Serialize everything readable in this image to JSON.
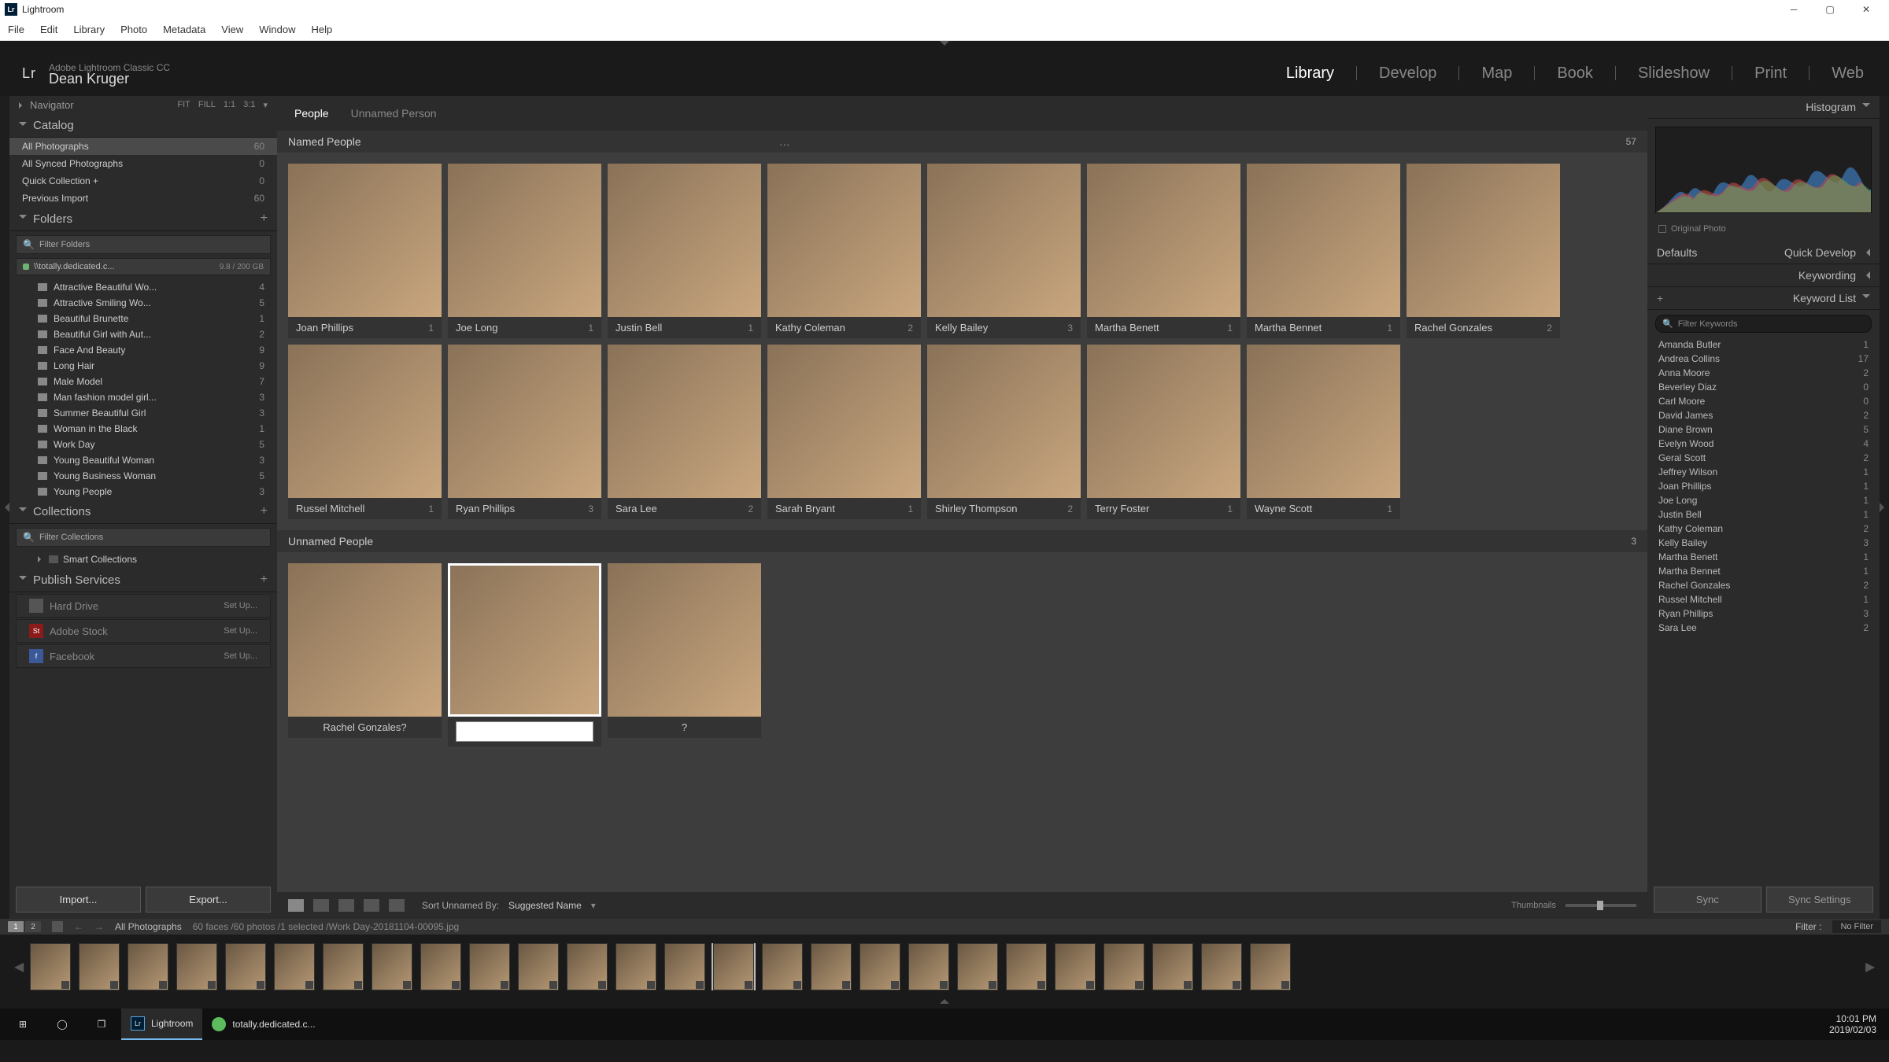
{
  "window": {
    "title": "Lightroom"
  },
  "menubar": [
    "File",
    "Edit",
    "Library",
    "Photo",
    "Metadata",
    "View",
    "Window",
    "Help"
  ],
  "header": {
    "logo": "Lr",
    "product": "Adobe Lightroom Classic CC",
    "user": "Dean Kruger",
    "modules": [
      "Library",
      "Develop",
      "Map",
      "Book",
      "Slideshow",
      "Print",
      "Web"
    ],
    "active_module": "Library"
  },
  "navigator": {
    "title": "Navigator",
    "zooms": [
      "FIT",
      "FILL",
      "1:1",
      "3:1"
    ]
  },
  "catalog": {
    "title": "Catalog",
    "items": [
      {
        "label": "All Photographs",
        "count": 60,
        "active": true
      },
      {
        "label": "All Synced Photographs",
        "count": 0
      },
      {
        "label": "Quick Collection  +",
        "count": 0
      },
      {
        "label": "Previous Import",
        "count": 60
      }
    ]
  },
  "folders": {
    "title": "Folders",
    "filter_placeholder": "Filter Folders",
    "volume": {
      "path": "\\\\totally.dedicated.c...",
      "stats": "9.8 / 200 GB"
    },
    "items": [
      {
        "label": "Attractive Beautiful Wo...",
        "count": 4
      },
      {
        "label": "Attractive Smiling Wo...",
        "count": 5
      },
      {
        "label": "Beautiful Brunette",
        "count": 1
      },
      {
        "label": "Beautiful Girl with Aut...",
        "count": 2
      },
      {
        "label": "Face And Beauty",
        "count": 9
      },
      {
        "label": "Long Hair",
        "count": 9
      },
      {
        "label": "Male Model",
        "count": 7
      },
      {
        "label": "Man fashion model girl...",
        "count": 3
      },
      {
        "label": "Summer Beautiful Girl",
        "count": 3
      },
      {
        "label": "Woman in the Black",
        "count": 1
      },
      {
        "label": "Work Day",
        "count": 5
      },
      {
        "label": "Young Beautiful Woman",
        "count": 3
      },
      {
        "label": "Young Business Woman",
        "count": 5
      },
      {
        "label": "Young People",
        "count": 3
      }
    ]
  },
  "collections": {
    "title": "Collections",
    "filter_placeholder": "Filter Collections",
    "smart_label": "Smart Collections"
  },
  "publish": {
    "title": "Publish Services",
    "setup": "Set Up...",
    "items": [
      {
        "label": "Hard Drive",
        "kind": "hd"
      },
      {
        "label": "Adobe Stock",
        "kind": "st"
      },
      {
        "label": "Facebook",
        "kind": "fb"
      }
    ]
  },
  "import_btn": "Import...",
  "export_btn": "Export...",
  "tabs": {
    "people": "People",
    "unnamed": "Unnamed Person",
    "active": "People"
  },
  "named": {
    "title": "Named People",
    "count": 57,
    "people": [
      {
        "name": "Joan Phillips",
        "count": 1
      },
      {
        "name": "Joe Long",
        "count": 1
      },
      {
        "name": "Justin Bell",
        "count": 1
      },
      {
        "name": "Kathy Coleman",
        "count": 2
      },
      {
        "name": "Kelly Bailey",
        "count": 3
      },
      {
        "name": "Martha Benett",
        "count": 1
      },
      {
        "name": "Martha Bennet",
        "count": 1
      },
      {
        "name": "Rachel Gonzales",
        "count": 2
      },
      {
        "name": "Russel Mitchell",
        "count": 1
      },
      {
        "name": "Ryan Phillips",
        "count": 3
      },
      {
        "name": "Sara Lee",
        "count": 2
      },
      {
        "name": "Sarah Bryant",
        "count": 1
      },
      {
        "name": "Shirley Thompson",
        "count": 2
      },
      {
        "name": "Terry Foster",
        "count": 1
      },
      {
        "name": "Wayne Scott",
        "count": 1
      }
    ]
  },
  "unnamed": {
    "title": "Unnamed People",
    "count": 3,
    "suggest": "Rachel Gonzales?",
    "unknown": "?"
  },
  "toolbar": {
    "sort_label": "Sort Unnamed By:",
    "sort_value": "Suggested Name",
    "thumb_label": "Thumbnails"
  },
  "right": {
    "histogram": "Histogram",
    "original_photo": "Original Photo",
    "defaults": "Defaults",
    "quick_develop": "Quick Develop",
    "keywording": "Keywording",
    "keyword_list": "Keyword List",
    "filter_keywords": "Filter Keywords",
    "keywords": [
      {
        "label": "Amanda Butler",
        "count": 1
      },
      {
        "label": "Andrea Collins",
        "count": 17
      },
      {
        "label": "Anna Moore",
        "count": 2
      },
      {
        "label": "Beverley Diaz",
        "count": 0
      },
      {
        "label": "Carl Moore",
        "count": 0
      },
      {
        "label": "David James",
        "count": 2
      },
      {
        "label": "Diane Brown",
        "count": 5
      },
      {
        "label": "Evelyn Wood",
        "count": 4
      },
      {
        "label": "Geral Scott",
        "count": 2
      },
      {
        "label": "Jeffrey Wilson",
        "count": 1
      },
      {
        "label": "Joan Phillips",
        "count": 1
      },
      {
        "label": "Joe Long",
        "count": 1
      },
      {
        "label": "Justin Bell",
        "count": 1
      },
      {
        "label": "Kathy Coleman",
        "count": 2
      },
      {
        "label": "Kelly Bailey",
        "count": 3
      },
      {
        "label": "Martha Benett",
        "count": 1
      },
      {
        "label": "Martha Bennet",
        "count": 1
      },
      {
        "label": "Rachel Gonzales",
        "count": 2
      },
      {
        "label": "Russel Mitchell",
        "count": 1
      },
      {
        "label": "Ryan Phillips",
        "count": 3
      },
      {
        "label": "Sara Lee",
        "count": 2
      }
    ],
    "sync": "Sync",
    "sync_settings": "Sync Settings"
  },
  "status": {
    "pages": [
      "1",
      "2"
    ],
    "collection": "All Photographs",
    "info": "60 faces /60 photos /1 selected /Work Day-20181104-00095.jpg",
    "filter_label": "Filter :",
    "filter_value": "No Filter"
  },
  "taskbar": {
    "app": "Lightroom",
    "srv": "totally.dedicated.c...",
    "time": "10:01 PM",
    "date": "2019/02/03"
  }
}
